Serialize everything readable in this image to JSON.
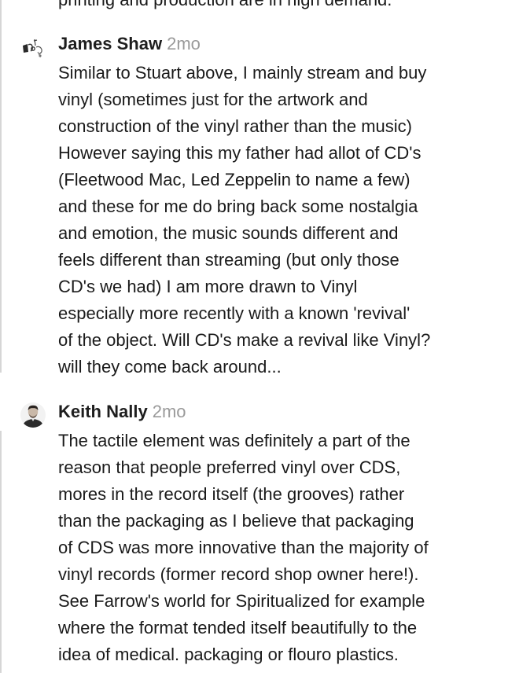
{
  "previous_comment": {
    "clipped_text": "printing and production are in high demand."
  },
  "comments": [
    {
      "author": "James Shaw",
      "time": "2mo",
      "avatar_icon": "line-drawing-avatar-icon",
      "body_lines": [
        "Similar to Stuart above, I mainly stream and buy",
        "vinyl (sometimes just for the artwork and",
        "construction of the vinyl rather than the music)",
        "However saying this my father had allot of CD's",
        "(Fleetwood Mac, Led Zeppelin to name a few)",
        "and these for me do bring back some nostalgia",
        "and emotion, the music sounds different and",
        "feels different than streaming (but only those",
        "CD's we had) I am more drawn to Vinyl",
        "especially more recently with a known 'revival'",
        "of the object. Will CD's make a revival like Vinyl?",
        "will they come back around..."
      ]
    },
    {
      "author": "Keith Nally",
      "time": "2mo",
      "avatar_icon": "portrait-avatar-icon",
      "body_lines": [
        "The tactile element was definitely a part of the",
        "reason that people preferred vinyl over CDS,",
        "mores in the record itself (the grooves) rather",
        "than the packaging as I believe that packaging",
        "of CDS was more innovative than the majority of",
        "vinyl records (former record shop owner here!).",
        "See Farrow's world for Spiritualized for example",
        "where the format tended itself beautifully to the",
        "idea of medical. packaging or flouro plastics."
      ]
    }
  ],
  "colors": {
    "text": "#1a1a1a",
    "author": "#1e1e1e",
    "timestamp": "#9a9a9a",
    "thread_line": "#d6d6d6"
  }
}
